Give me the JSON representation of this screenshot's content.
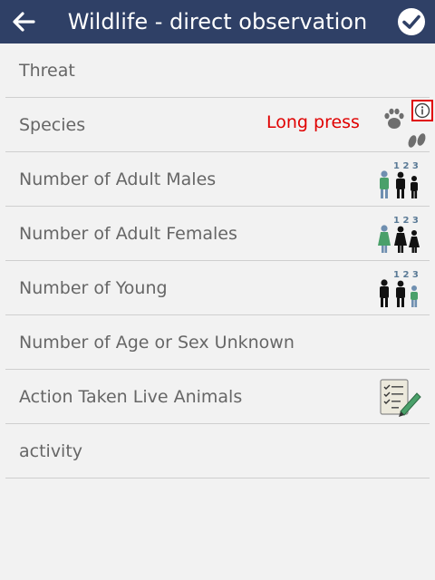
{
  "app_bar": {
    "title": "Wildlife - direct observation",
    "back_icon": "arrow-left-icon",
    "done_icon": "check-circle-icon",
    "bg_color": "#2f4066"
  },
  "rows": [
    {
      "label": "Threat"
    },
    {
      "label": "Species",
      "hint": "Long press",
      "icon": "paw-prints-icon",
      "info_icon": "info-icon"
    },
    {
      "label": "Number of Adult Males",
      "icon": "count-adult-males-icon",
      "icon_numbers": "1 2 3"
    },
    {
      "label": "Number of Adult Females",
      "icon": "count-adult-females-icon",
      "icon_numbers": "1 2 3"
    },
    {
      "label": "Number of Young",
      "icon": "count-young-icon",
      "icon_numbers": "1 2 3"
    },
    {
      "label": "Number of Age or Sex Unknown"
    },
    {
      "label": "Action Taken Live Animals",
      "icon": "checklist-pencil-icon"
    },
    {
      "label": "activity"
    }
  ],
  "colors": {
    "hint": "#e00000",
    "label": "#666666",
    "accent_green": "#4aa06a",
    "accent_blue": "#6f8fb0"
  }
}
